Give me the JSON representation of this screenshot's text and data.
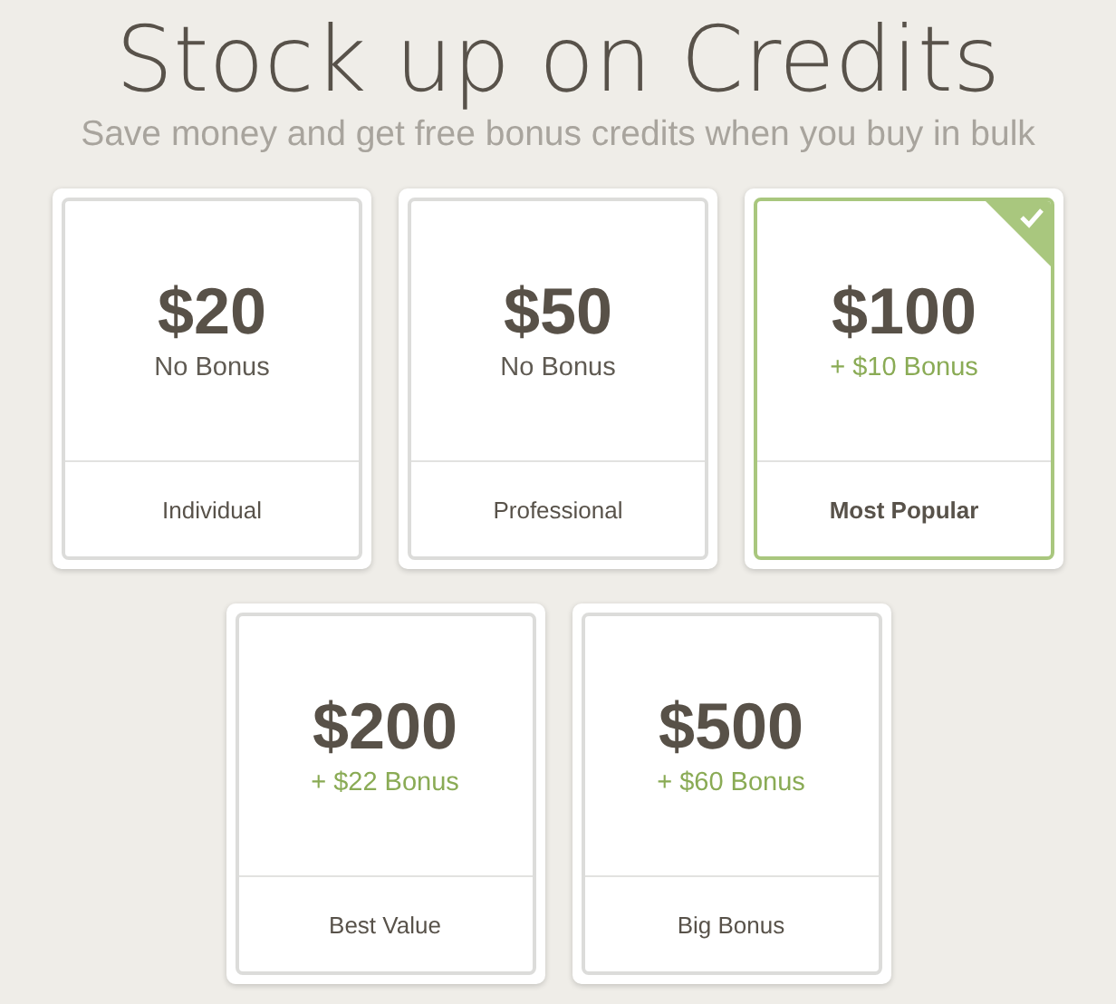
{
  "header": {
    "title": "Stock up on Credits",
    "subtitle": "Save money and get free bonus credits when you buy in bulk"
  },
  "packages": [
    {
      "price": "$20",
      "bonus": "No Bonus",
      "kind": "plain",
      "label": "Individual",
      "selected": false
    },
    {
      "price": "$50",
      "bonus": "No Bonus",
      "kind": "plain",
      "label": "Professional",
      "selected": false
    },
    {
      "price": "$100",
      "bonus": "+ $10 Bonus",
      "kind": "bonus",
      "label": "Most Popular",
      "selected": true
    },
    {
      "price": "$200",
      "bonus": "+ $22 Bonus",
      "kind": "bonus",
      "label": "Best Value",
      "selected": false
    },
    {
      "price": "$500",
      "bonus": "+ $60 Bonus",
      "kind": "bonus",
      "label": "Big Bonus",
      "selected": false
    }
  ]
}
